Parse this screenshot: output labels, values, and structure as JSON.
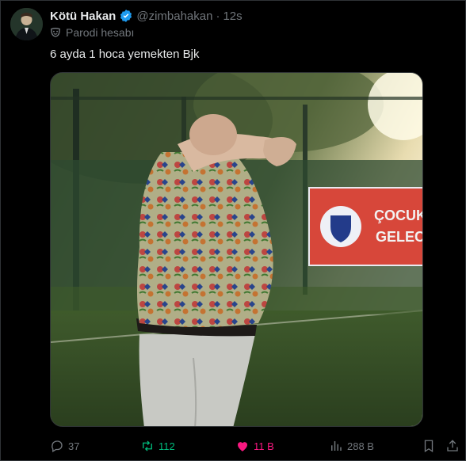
{
  "author": {
    "name": "Kötü Hakan",
    "handle": "@zimbahakan",
    "separator": "·",
    "time": "12s",
    "verified_color": "#1d9bf0"
  },
  "label": {
    "icon": "parody-mask-icon",
    "text": "Parodi hesabı"
  },
  "tweet": {
    "text": "6 ayda 1 hoca yemekten Bjk"
  },
  "media": {
    "banner_text_line1": "ÇOCUKL",
    "banner_text_line2": "GELEC"
  },
  "actions": {
    "replies": "37",
    "retweets": "112",
    "likes": "11 B",
    "views": "288 B",
    "retweet_color": "#00ba7c",
    "like_color": "#f91880"
  }
}
